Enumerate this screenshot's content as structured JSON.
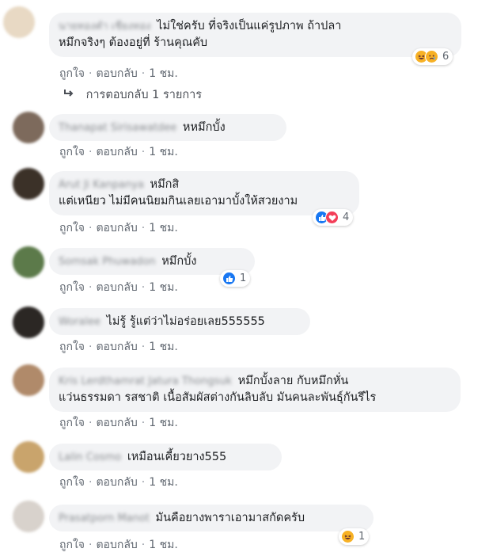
{
  "comments": [
    {
      "author": "นายทองคำ เชียงทอง",
      "lines": [
        "ไม่ใช่ครับ ที่จริงเป็นแค่รูปภาพ ถ้าปลา",
        "หมึกจริงๆ ต้องอยู่ที่ ร้านคุณคับ"
      ],
      "like": "ถูกใจ",
      "reply": "ตอบกลับ",
      "time": "1 ชม.",
      "reactions": {
        "icons": [
          "haha",
          "sad"
        ],
        "count": "6"
      }
    },
    {
      "author": "Thanapat Sirisawatdee",
      "lines": [
        "หหมึกบั้ง"
      ],
      "like": "ถูกใจ",
      "reply": "ตอบกลับ",
      "time": "1 ชม."
    },
    {
      "author": "Arut Ji Kanpanya",
      "lines": [
        "หมึกสิ",
        "แต่เหนียว ไม่มีคนนิยมกินเลยเอามาบั้งให้สวยงาม"
      ],
      "like": "ถูกใจ",
      "reply": "ตอบกลับ",
      "time": "1 ชม.",
      "reactions": {
        "icons": [
          "like",
          "love"
        ],
        "count": "4"
      }
    },
    {
      "author": "Somsak Phuwadon",
      "lines": [
        "หมึกบั้ง"
      ],
      "like": "ถูกใจ",
      "reply": "ตอบกลับ",
      "time": "1 ชม.",
      "reactions": {
        "icons": [
          "like"
        ],
        "count": "1"
      }
    },
    {
      "author": "Woralee",
      "lines": [
        "ไม่รู้ รู้แต่ว่าไม่อร่อยเลย555555"
      ],
      "like": "ถูกใจ",
      "reply": "ตอบกลับ",
      "time": "1 ชม."
    },
    {
      "author": "Kris Lerdthamrat Jatura Thongsuk",
      "lines": [
        "หมึกบั้งลาย กับหมึกหั่น",
        "แว่นธรรมดา รสชาติ เนื้อสัมผัสต่างกันลิบลับ มันคนละพันธุ์กันรึไร"
      ],
      "like": "ถูกใจ",
      "reply": "ตอบกลับ",
      "time": "1 ชม."
    },
    {
      "author": "Lalin Cosmo",
      "lines": [
        "เหมือนเคี้ยวยาง555"
      ],
      "like": "ถูกใจ",
      "reply": "ตอบกลับ",
      "time": "1 ชม."
    },
    {
      "author": "Prasatporn Manot",
      "lines": [
        "มันคือยางพาราเอามาสกัดครับ"
      ],
      "like": "ถูกใจ",
      "reply": "ตอบกลับ",
      "time": "1 ชม.",
      "reactions": {
        "icons": [
          "haha"
        ],
        "count": "1"
      }
    }
  ],
  "reply_summary": {
    "label": "การตอบกลับ 1 รายการ"
  },
  "colors": {
    "bubble": "#f2f3f5",
    "link": "#606770",
    "like": "#1877f2",
    "love": "#f33e58",
    "haha": "#f7b125"
  }
}
